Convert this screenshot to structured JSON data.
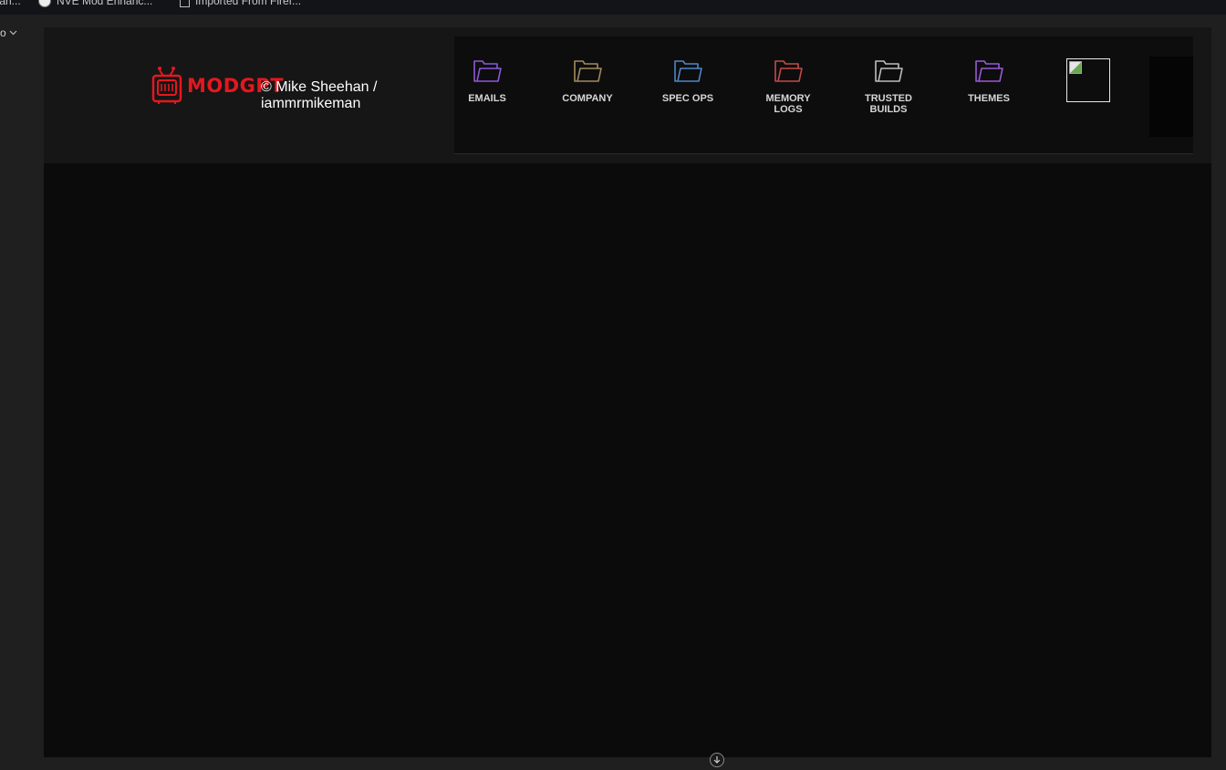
{
  "browser": {
    "bookmarks": [
      {
        "label": "tan..."
      },
      {
        "label": "NVE Mod Enhanc..."
      },
      {
        "label": "Imported From Firef..."
      }
    ],
    "left_dropdown_label": "o"
  },
  "header": {
    "logo_text": "MODGPT",
    "credit_line1": "© Mike Sheehan /",
    "credit_line2": "iammrmikeman"
  },
  "nav": {
    "items": [
      {
        "label": "EMAILS",
        "icon": "folder-icon",
        "color": "#8a5ad8"
      },
      {
        "label": "COMPANY",
        "icon": "folder-icon",
        "color": "#a38a5e"
      },
      {
        "label": "SPEC OPS",
        "icon": "folder-icon",
        "color": "#4f86c6"
      },
      {
        "label": "MEMORY\nLOGS",
        "icon": "folder-icon",
        "color": "#c44a4a"
      },
      {
        "label": "TRUSTED\nBUILDS",
        "icon": "folder-icon",
        "color": "#bdbdbd"
      },
      {
        "label": "THEMES",
        "icon": "folder-icon",
        "color": "#9a5ad8"
      }
    ]
  },
  "colors": {
    "brand_red": "#e5171f",
    "header_bg": "#161616",
    "content_bg": "#0b0b0b"
  }
}
